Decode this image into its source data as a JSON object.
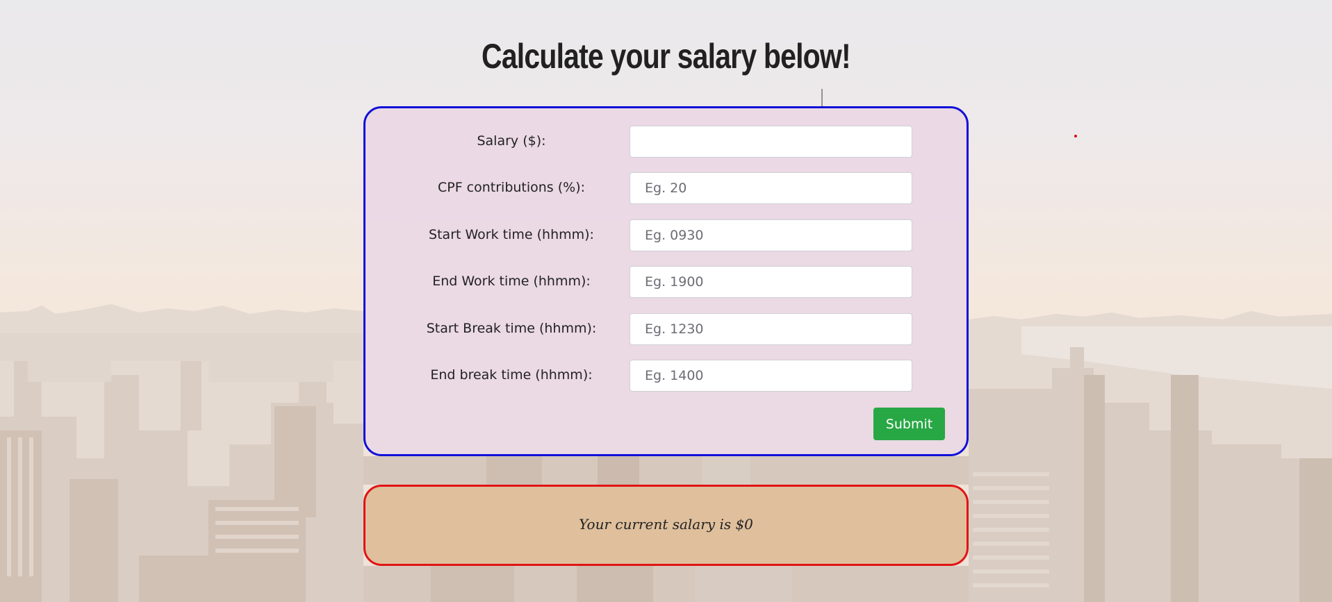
{
  "page": {
    "title": "Calculate your salary below!"
  },
  "form": {
    "fields": [
      {
        "label": "Salary ($):",
        "placeholder": "",
        "value": ""
      },
      {
        "label": "CPF contributions (%):",
        "placeholder": "Eg. 20",
        "value": ""
      },
      {
        "label": "Start Work time (hhmm):",
        "placeholder": "Eg. 0930",
        "value": ""
      },
      {
        "label": "End Work time (hhmm):",
        "placeholder": "Eg. 1900",
        "value": ""
      },
      {
        "label": "Start Break time (hhmm):",
        "placeholder": "Eg. 1230",
        "value": ""
      },
      {
        "label": "End break time (hhmm):",
        "placeholder": "Eg. 1400",
        "value": ""
      }
    ],
    "submit_label": "Submit"
  },
  "result": {
    "text": "Your current salary is $0"
  },
  "colors": {
    "form_border": "#1010d8",
    "form_background": "#ead8e4",
    "result_border": "#e01414",
    "result_background": "#debe9a",
    "submit_button": "#28a745"
  }
}
